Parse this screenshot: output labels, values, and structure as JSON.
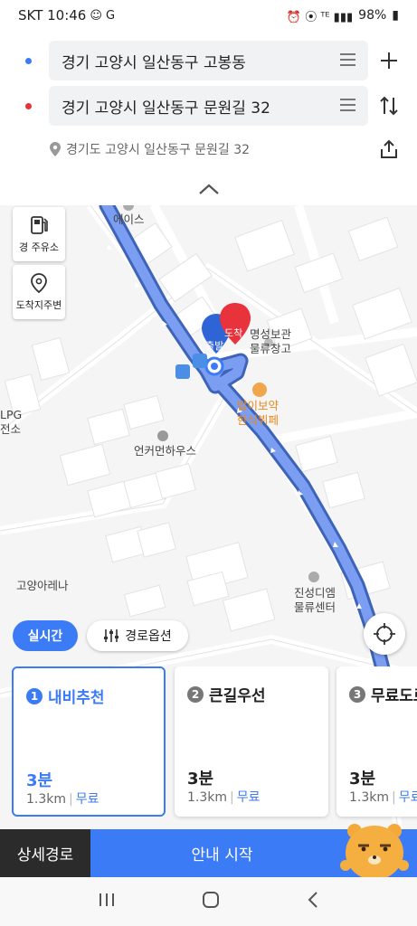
{
  "status_bar": {
    "carrier_time": "SKT 10:46",
    "battery": "98%"
  },
  "route": {
    "origin": "경기 고양시 일산동구 고봉동",
    "destination": "경기 고양시 일산동구 문원길 32",
    "destination_address": "경기도 고양시 일산동구 문원길 32",
    "origin_color": "#3b7bf5",
    "destination_color": "#e8323c"
  },
  "map": {
    "tools": [
      {
        "label": "경 주유소",
        "icon": "gas-station-icon"
      },
      {
        "label": "도착지주변",
        "icon": "map-pin-icon"
      }
    ],
    "labels": {
      "ace": "에이스",
      "myeongseong": "명성보관\n물류창고",
      "bapibo": "밥이보약\n한식뷔페",
      "unkumhouse": "언커먼하우스",
      "lpg": "LPG\n전소",
      "goyang_arena": "고양아레나",
      "jinseong": "진성디엠\n물류센터"
    },
    "start_badge": "출발",
    "end_badge": "도착",
    "realtime_label": "실시간",
    "route_options_label": "경로옵션"
  },
  "route_cards": [
    {
      "index": "1",
      "title": "내비추천",
      "time": "3분",
      "distance": "1.3km",
      "fee": "무료",
      "selected": true
    },
    {
      "index": "2",
      "title": "큰길우선",
      "time": "3분",
      "distance": "1.3km",
      "fee": "무료",
      "selected": false
    },
    {
      "index": "3",
      "title": "무료도로",
      "time": "3분",
      "distance": "1.3km",
      "fee": "무료",
      "selected": false
    }
  ],
  "actions": {
    "detail_route": "상세경로",
    "start_navigation": "안내 시작"
  }
}
